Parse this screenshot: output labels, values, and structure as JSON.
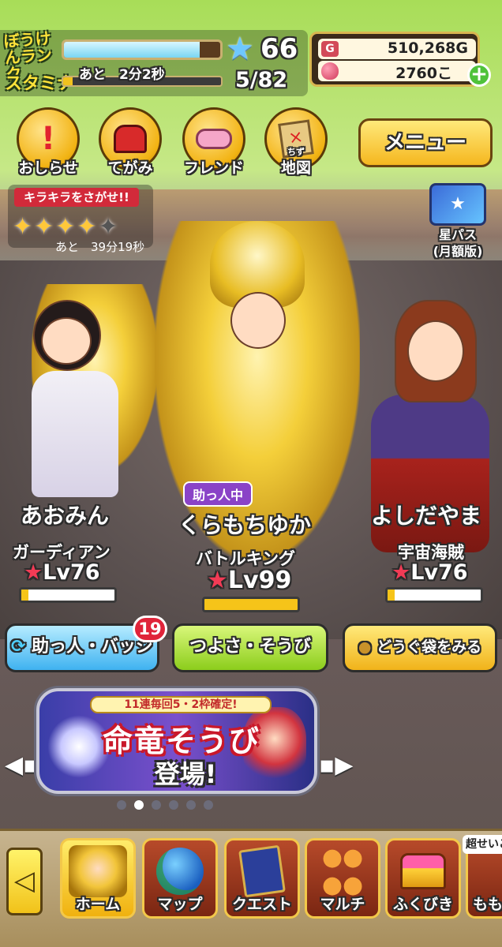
{
  "header": {
    "rank_label": "ぼうけんランク",
    "rank_value": "66",
    "rank_progress": 0.87,
    "stamina_label": "スタミナ",
    "stamina_timer": "あと　2分2秒",
    "stamina_value": "5/82",
    "stamina_progress": 0.06,
    "gold": "510,268G",
    "gems": "2760こ"
  },
  "top_buttons": [
    {
      "label": "おしらせ",
      "icon": "exclamation-icon"
    },
    {
      "label": "てがみ",
      "icon": "mailbox-icon"
    },
    {
      "label": "フレンド",
      "icon": "handshake-icon"
    },
    {
      "label": "地図",
      "ruby": "ちず",
      "icon": "map-icon"
    }
  ],
  "menu_label": "メニュー",
  "kirakira": {
    "title": "キラキラをさがせ!!",
    "stars_filled": 4,
    "stars_total": 5,
    "timer": "あと　39分19秒"
  },
  "starpass": {
    "line1": "星パス",
    "line2": "(月額版)"
  },
  "party": [
    {
      "name": "あおみん",
      "job": "ガーディアン",
      "level": "Lv76",
      "hp": 0.08
    },
    {
      "name": "くらもちゆか",
      "job": "バトルキング",
      "level": "Lv99",
      "hp": 1.0,
      "badge": "助っ人中"
    },
    {
      "name": "よしだやま",
      "job": "宇宙海賊",
      "level": "Lv76",
      "hp": 0.08
    }
  ],
  "actions": {
    "helper": "助っ人・バッジ",
    "helper_badge": "19",
    "strength": "つよさ・そうび",
    "bag": "どうぐ袋をみる"
  },
  "banner": {
    "top": "11連毎回5・2枠確定!",
    "title": "命竜そうび",
    "sub": "登場!",
    "page_count": 6,
    "active_page": 1
  },
  "nav": [
    {
      "label": "ホーム",
      "icon": "hero-portrait-icon"
    },
    {
      "label": "マップ",
      "icon": "globe-icon"
    },
    {
      "label": "クエスト",
      "icon": "book-icon"
    },
    {
      "label": "マルチ",
      "icon": "party-icon"
    },
    {
      "label": "ふくびき",
      "icon": "treasure-chest-icon"
    }
  ],
  "nav_extra": {
    "tag": "超せいこ",
    "label": "もも"
  },
  "colors": {
    "gold_accent": "#f2b313",
    "level_star": "#f23b55",
    "hp_fill": "#f6c419",
    "badge_red": "#e0243a"
  }
}
